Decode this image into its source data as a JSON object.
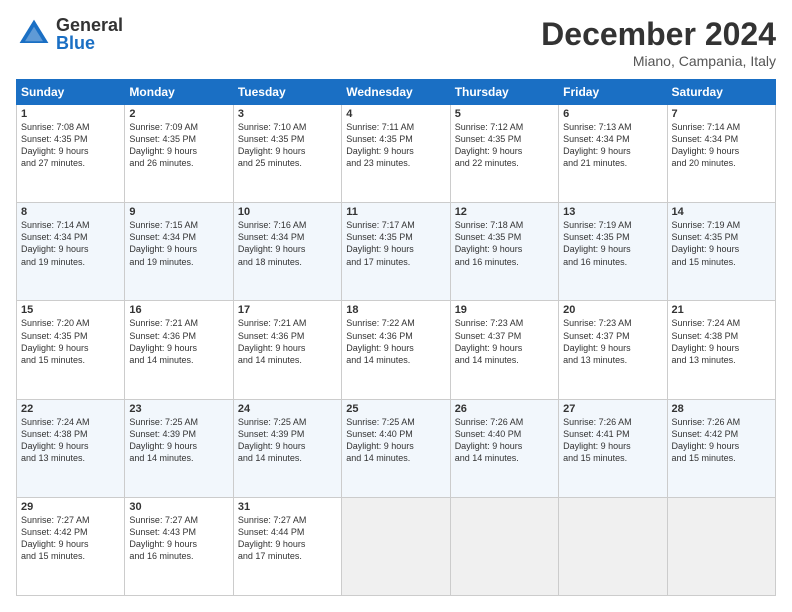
{
  "logo": {
    "general": "General",
    "blue": "Blue"
  },
  "header": {
    "month": "December 2024",
    "location": "Miano, Campania, Italy"
  },
  "weekdays": [
    "Sunday",
    "Monday",
    "Tuesday",
    "Wednesday",
    "Thursday",
    "Friday",
    "Saturday"
  ],
  "weeks": [
    [
      {
        "day": "1",
        "info": "Sunrise: 7:08 AM\nSunset: 4:35 PM\nDaylight: 9 hours\nand 27 minutes."
      },
      {
        "day": "2",
        "info": "Sunrise: 7:09 AM\nSunset: 4:35 PM\nDaylight: 9 hours\nand 26 minutes."
      },
      {
        "day": "3",
        "info": "Sunrise: 7:10 AM\nSunset: 4:35 PM\nDaylight: 9 hours\nand 25 minutes."
      },
      {
        "day": "4",
        "info": "Sunrise: 7:11 AM\nSunset: 4:35 PM\nDaylight: 9 hours\nand 23 minutes."
      },
      {
        "day": "5",
        "info": "Sunrise: 7:12 AM\nSunset: 4:35 PM\nDaylight: 9 hours\nand 22 minutes."
      },
      {
        "day": "6",
        "info": "Sunrise: 7:13 AM\nSunset: 4:34 PM\nDaylight: 9 hours\nand 21 minutes."
      },
      {
        "day": "7",
        "info": "Sunrise: 7:14 AM\nSunset: 4:34 PM\nDaylight: 9 hours\nand 20 minutes."
      }
    ],
    [
      {
        "day": "8",
        "info": "Sunrise: 7:14 AM\nSunset: 4:34 PM\nDaylight: 9 hours\nand 19 minutes."
      },
      {
        "day": "9",
        "info": "Sunrise: 7:15 AM\nSunset: 4:34 PM\nDaylight: 9 hours\nand 19 minutes."
      },
      {
        "day": "10",
        "info": "Sunrise: 7:16 AM\nSunset: 4:34 PM\nDaylight: 9 hours\nand 18 minutes."
      },
      {
        "day": "11",
        "info": "Sunrise: 7:17 AM\nSunset: 4:35 PM\nDaylight: 9 hours\nand 17 minutes."
      },
      {
        "day": "12",
        "info": "Sunrise: 7:18 AM\nSunset: 4:35 PM\nDaylight: 9 hours\nand 16 minutes."
      },
      {
        "day": "13",
        "info": "Sunrise: 7:19 AM\nSunset: 4:35 PM\nDaylight: 9 hours\nand 16 minutes."
      },
      {
        "day": "14",
        "info": "Sunrise: 7:19 AM\nSunset: 4:35 PM\nDaylight: 9 hours\nand 15 minutes."
      }
    ],
    [
      {
        "day": "15",
        "info": "Sunrise: 7:20 AM\nSunset: 4:35 PM\nDaylight: 9 hours\nand 15 minutes."
      },
      {
        "day": "16",
        "info": "Sunrise: 7:21 AM\nSunset: 4:36 PM\nDaylight: 9 hours\nand 14 minutes."
      },
      {
        "day": "17",
        "info": "Sunrise: 7:21 AM\nSunset: 4:36 PM\nDaylight: 9 hours\nand 14 minutes."
      },
      {
        "day": "18",
        "info": "Sunrise: 7:22 AM\nSunset: 4:36 PM\nDaylight: 9 hours\nand 14 minutes."
      },
      {
        "day": "19",
        "info": "Sunrise: 7:23 AM\nSunset: 4:37 PM\nDaylight: 9 hours\nand 14 minutes."
      },
      {
        "day": "20",
        "info": "Sunrise: 7:23 AM\nSunset: 4:37 PM\nDaylight: 9 hours\nand 13 minutes."
      },
      {
        "day": "21",
        "info": "Sunrise: 7:24 AM\nSunset: 4:38 PM\nDaylight: 9 hours\nand 13 minutes."
      }
    ],
    [
      {
        "day": "22",
        "info": "Sunrise: 7:24 AM\nSunset: 4:38 PM\nDaylight: 9 hours\nand 13 minutes."
      },
      {
        "day": "23",
        "info": "Sunrise: 7:25 AM\nSunset: 4:39 PM\nDaylight: 9 hours\nand 14 minutes."
      },
      {
        "day": "24",
        "info": "Sunrise: 7:25 AM\nSunset: 4:39 PM\nDaylight: 9 hours\nand 14 minutes."
      },
      {
        "day": "25",
        "info": "Sunrise: 7:25 AM\nSunset: 4:40 PM\nDaylight: 9 hours\nand 14 minutes."
      },
      {
        "day": "26",
        "info": "Sunrise: 7:26 AM\nSunset: 4:40 PM\nDaylight: 9 hours\nand 14 minutes."
      },
      {
        "day": "27",
        "info": "Sunrise: 7:26 AM\nSunset: 4:41 PM\nDaylight: 9 hours\nand 15 minutes."
      },
      {
        "day": "28",
        "info": "Sunrise: 7:26 AM\nSunset: 4:42 PM\nDaylight: 9 hours\nand 15 minutes."
      }
    ],
    [
      {
        "day": "29",
        "info": "Sunrise: 7:27 AM\nSunset: 4:42 PM\nDaylight: 9 hours\nand 15 minutes."
      },
      {
        "day": "30",
        "info": "Sunrise: 7:27 AM\nSunset: 4:43 PM\nDaylight: 9 hours\nand 16 minutes."
      },
      {
        "day": "31",
        "info": "Sunrise: 7:27 AM\nSunset: 4:44 PM\nDaylight: 9 hours\nand 17 minutes."
      },
      null,
      null,
      null,
      null
    ]
  ]
}
